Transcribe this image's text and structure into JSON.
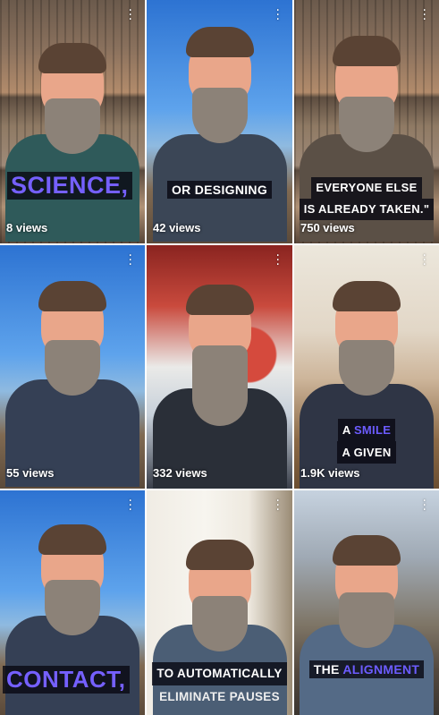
{
  "tiles": [
    {
      "views": "8 views",
      "caption_big": "SCIENCE,"
    },
    {
      "views": "42 views",
      "caption_lines": [
        "OR DESIGNING"
      ]
    },
    {
      "views": "750 views",
      "caption_lines": [
        "EVERYONE ELSE",
        "IS ALREADY TAKEN.\""
      ]
    },
    {
      "views": "55 views"
    },
    {
      "views": "332 views"
    },
    {
      "views": "1.9K views",
      "caption_line1_pre": "A ",
      "caption_line1_accent": "SMILE",
      "caption_line2": "A GIVEN"
    },
    {
      "caption_big": "CONTACT,"
    },
    {
      "caption_lines": [
        "TO AUTOMATICALLY",
        "ELIMINATE PAUSES"
      ]
    },
    {
      "caption_pre": "THE ",
      "caption_accent": "ALIGNMENT"
    }
  ],
  "more_icon": "more-vertical-icon",
  "colors": {
    "accent": "#7560ff",
    "caption_bg": "#0a0a14"
  }
}
